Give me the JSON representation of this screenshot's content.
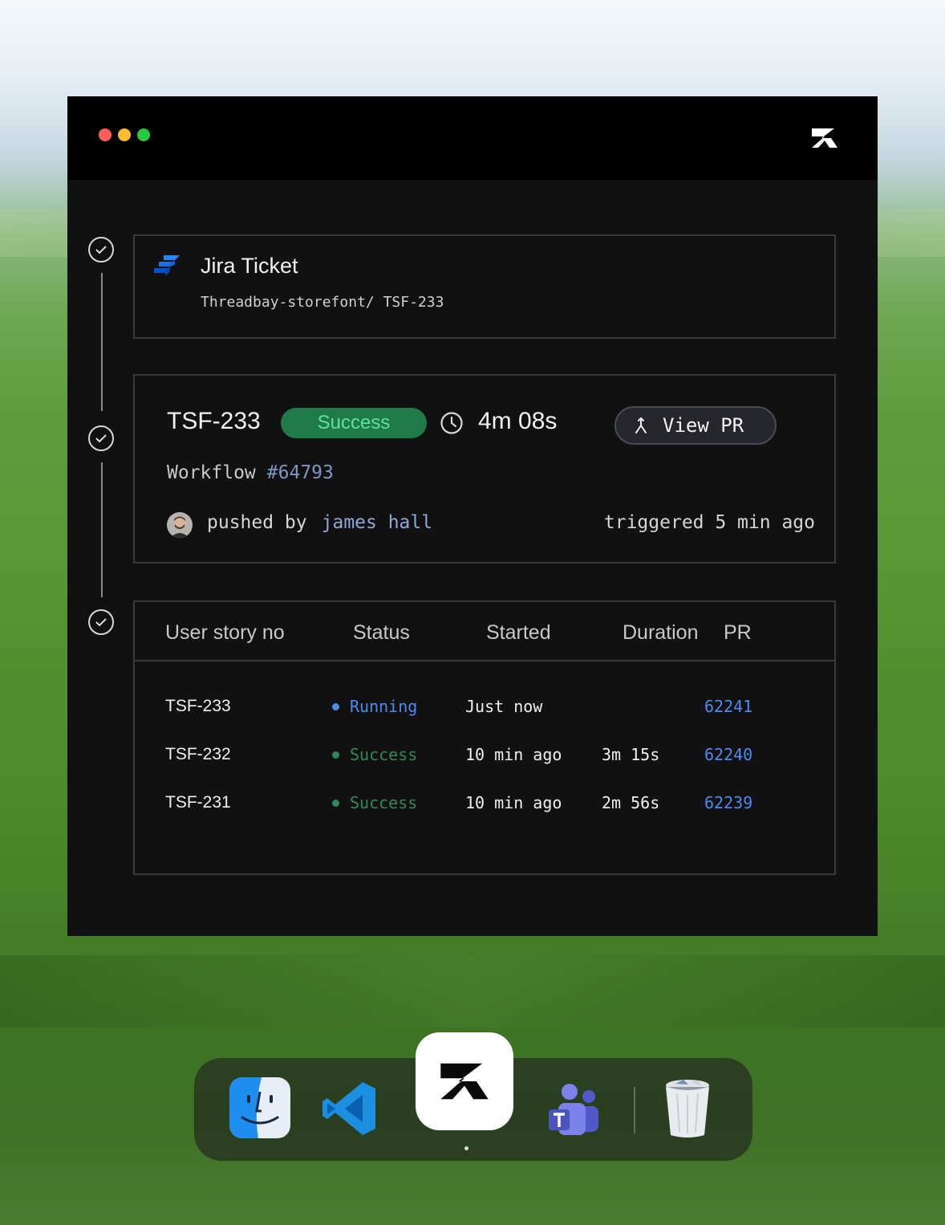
{
  "window": {
    "controls": [
      "close",
      "minimize",
      "maximize"
    ],
    "logo_icon": "brand-logo-icon"
  },
  "jira_card": {
    "title": "Jira Ticket",
    "path": "Threadbay-storefont/ TSF-233",
    "icon": "jira-icon"
  },
  "run_card": {
    "ticket_id": "TSF-233",
    "status_badge": "Success",
    "duration": "4m 08s",
    "view_pr_label": "View PR",
    "workflow_label": "Workflow",
    "workflow_id": "#64793",
    "pushed_by_label": "pushed by",
    "pushed_by_user": "james hall",
    "triggered_text": "triggered 5 min ago"
  },
  "runs_table": {
    "headers": {
      "story": "User story no",
      "status": "Status",
      "started": "Started",
      "duration": "Duration",
      "pr": "PR"
    },
    "rows": [
      {
        "story": "TSF-233",
        "status": "Running",
        "started": "Just now",
        "duration": "",
        "pr": "62241"
      },
      {
        "story": "TSF-232",
        "status": "Success",
        "started": "10 min ago",
        "duration": "3m 15s",
        "pr": "62240"
      },
      {
        "story": "TSF-231",
        "status": "Success",
        "started": "10 min ago",
        "duration": "2m 56s",
        "pr": "62239"
      }
    ]
  },
  "dock": {
    "apps": [
      "finder-icon",
      "vscode-icon",
      "brand-app-icon",
      "teams-icon",
      "trash-icon"
    ]
  },
  "colors": {
    "success": "#1e7a46",
    "success_text": "#5fe09a",
    "running": "#4a8cf0",
    "link": "#4a8cf0",
    "window_bg": "#111111"
  }
}
